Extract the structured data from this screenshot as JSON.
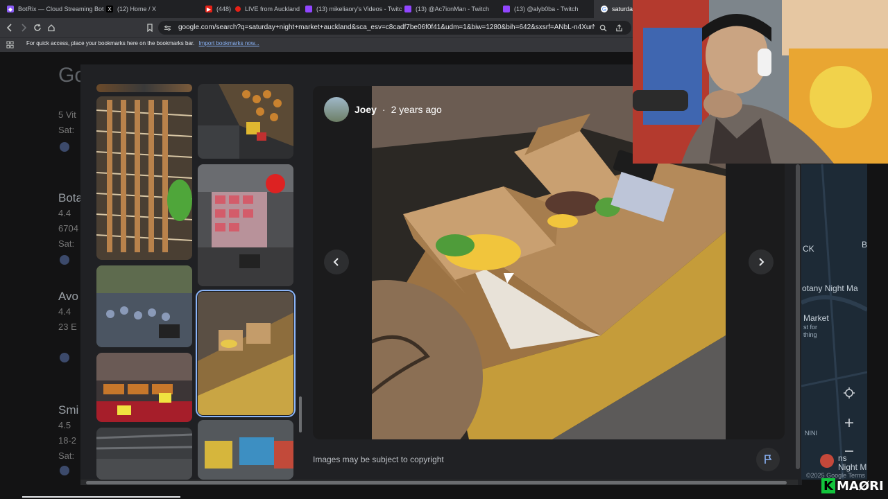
{
  "browser": {
    "tabs": [
      {
        "label": "BotRix — Cloud Streaming Bot",
        "icon": "botrix-icon"
      },
      {
        "label": "(12) Home / X",
        "icon": "x-icon"
      },
      {
        "label": "(448)",
        "icon": "youtube-icon"
      },
      {
        "label": "LIVE from Auckland",
        "icon": "live-icon"
      },
      {
        "label": "(13) mikeliaory's Videos - Twitch",
        "icon": "twitch-icon"
      },
      {
        "label": "(13) @Ac7ionMan - Twitch",
        "icon": "twitch-icon"
      },
      {
        "label": "(13) @alyb0ba - Twitch",
        "icon": "twitch-icon"
      },
      {
        "label": "saturday",
        "icon": "google-icon"
      }
    ],
    "url": "google.com/search?q=saturday+night+market+auckland&sca_esv=c8cadf7be06f0f41&udm=1&biw=1280&bih=642&sxsrf=ANbL-n4XurNB3p...",
    "bookmarks_prompt": "For quick access, place your bookmarks here on the bookmarks bar.",
    "bookmarks_link": "Import bookmarks now..."
  },
  "background_results": {
    "logo": "Go",
    "rows": [
      {
        "title": "",
        "lines": [
          "5 Vit",
          "Sat:"
        ]
      },
      {
        "title": "Bota",
        "lines": [
          "4.4",
          "6704",
          "Sat:"
        ]
      },
      {
        "title": "Avo",
        "lines": [
          "4.4",
          "23 E",
          ""
        ]
      },
      {
        "title": "Smi",
        "lines": [
          "4.5",
          "18-2",
          "Sat:"
        ]
      }
    ]
  },
  "viewer": {
    "author": "Joey",
    "separator": "·",
    "age": "2 years ago",
    "copyright": "Images may be subject to copyright",
    "prev_icon": "chevron-left-icon",
    "next_icon": "chevron-right-icon",
    "flag_icon": "flag-icon"
  },
  "map": {
    "labels": [
      "CK",
      "B",
      "otany Night Ma",
      "Market",
      "st for",
      "thing",
      "NINI",
      "ns",
      "Night M"
    ],
    "credit": "©2025 Google  Terms"
  },
  "brand": {
    "letter": "K",
    "name": "MAØRI"
  },
  "colors": {
    "accent": "#8ab4f8",
    "brand_green": "#12c43c"
  }
}
